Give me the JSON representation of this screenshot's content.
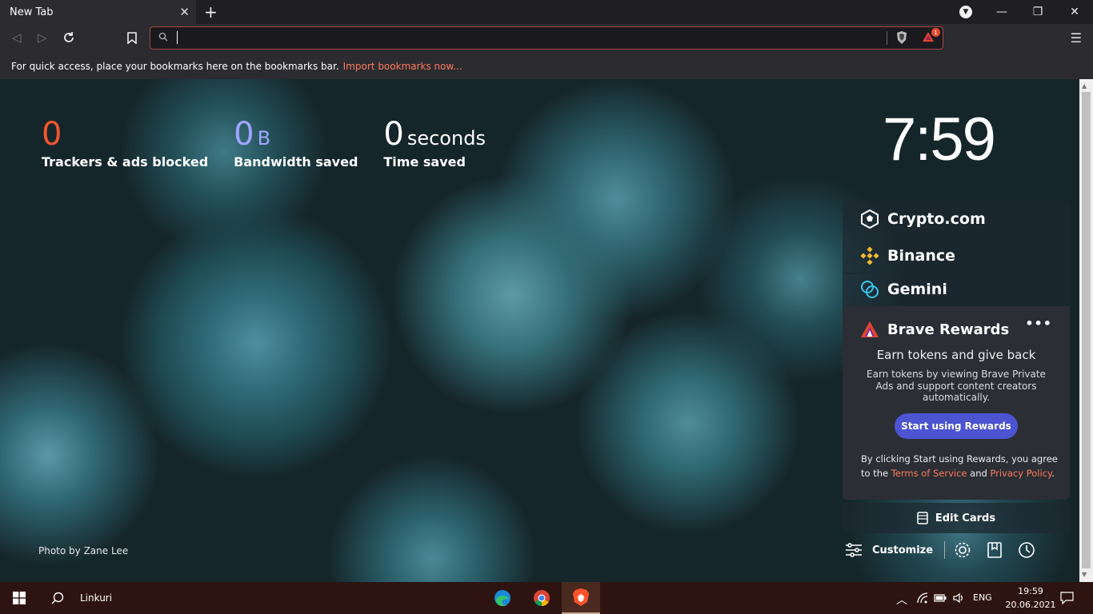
{
  "browser": {
    "tab_title": "New Tab",
    "tab_close": "✕",
    "new_tab": "+",
    "window_controls": {
      "minimize": "—",
      "maximize": "❐",
      "close": "✕"
    },
    "address_value": "",
    "rewards_badge": "1",
    "menu": "☰"
  },
  "bookmarks_bar": {
    "message": "For quick access, place your bookmarks here on the bookmarks bar.",
    "import_link": "Import bookmarks now..."
  },
  "stats": [
    {
      "value": "0",
      "unit": "",
      "label": "Trackers & ads blocked",
      "color": "#f2562f"
    },
    {
      "value": "0",
      "unit": "B",
      "label": "Bandwidth saved",
      "color": "#a0a5ff"
    },
    {
      "value": "0",
      "unit": "seconds",
      "label": "Time saved",
      "color": "#ffffff"
    }
  ],
  "clock": "7:59",
  "photo_credit": "Photo by Zane Lee",
  "widgets": {
    "crypto_com": "Crypto.com",
    "binance": "Binance",
    "gemini": "Gemini"
  },
  "rewards": {
    "title": "Brave Rewards",
    "more": "•••",
    "subtitle": "Earn tokens and give back",
    "description": "Earn tokens by viewing Brave Private Ads and support content creators automatically.",
    "cta": "Start using Rewards",
    "terms_prefix": "By clicking Start using Rewards, you agree to the ",
    "terms_link": "Terms of Service",
    "terms_and": " and ",
    "privacy_link": "Privacy Policy",
    "terms_suffix": "."
  },
  "edit_cards": "Edit Cards",
  "customize": "Customize",
  "taskbar": {
    "search_label": "Linkuri",
    "language": "ENG",
    "time": "19:59",
    "date": "20.06.2021"
  },
  "colors": {
    "accent_orange": "#f2562f",
    "link_orange": "#ff7a5a",
    "rewards_button": "#4c54d2",
    "omnibox_border": "#a84646"
  }
}
